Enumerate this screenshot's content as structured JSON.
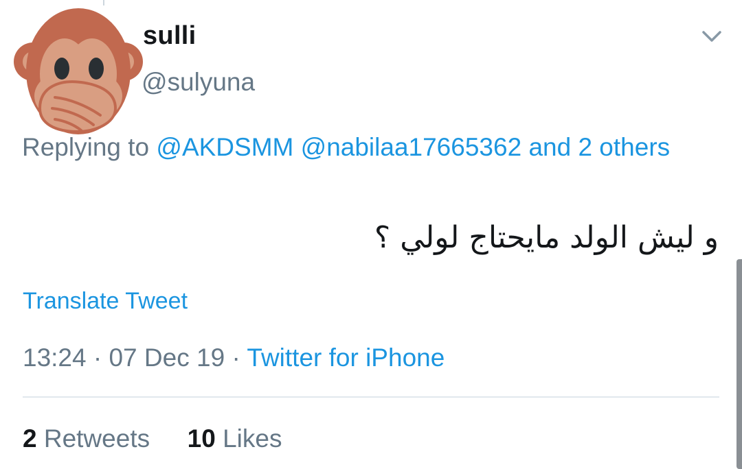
{
  "tweet": {
    "display_name": "sulli",
    "handle": "@sulyuna",
    "avatar_icon": "speak-no-evil-monkey-icon",
    "menu_icon": "chevron-down-icon",
    "reply": {
      "prefix": "Replying to",
      "mention_1": "@AKDSMM",
      "mention_2": "@nabilaa17665362",
      "others_link": "and 2 others"
    },
    "text": "و ليش الولد مايحتاج لولي ؟",
    "translate_label": "Translate Tweet",
    "time": "13:24",
    "separator": "·",
    "date": "07 Dec 19",
    "source": "Twitter for iPhone",
    "retweets_count": "2",
    "retweets_label": "Retweets",
    "likes_count": "10",
    "likes_label": "Likes"
  },
  "colors": {
    "link_blue": "#1b95e0",
    "secondary_gray": "#657786",
    "primary_text": "#14171a",
    "divider": "#e1e8ed",
    "monkey_fur": "#c1694f",
    "monkey_face": "#d99e82"
  }
}
